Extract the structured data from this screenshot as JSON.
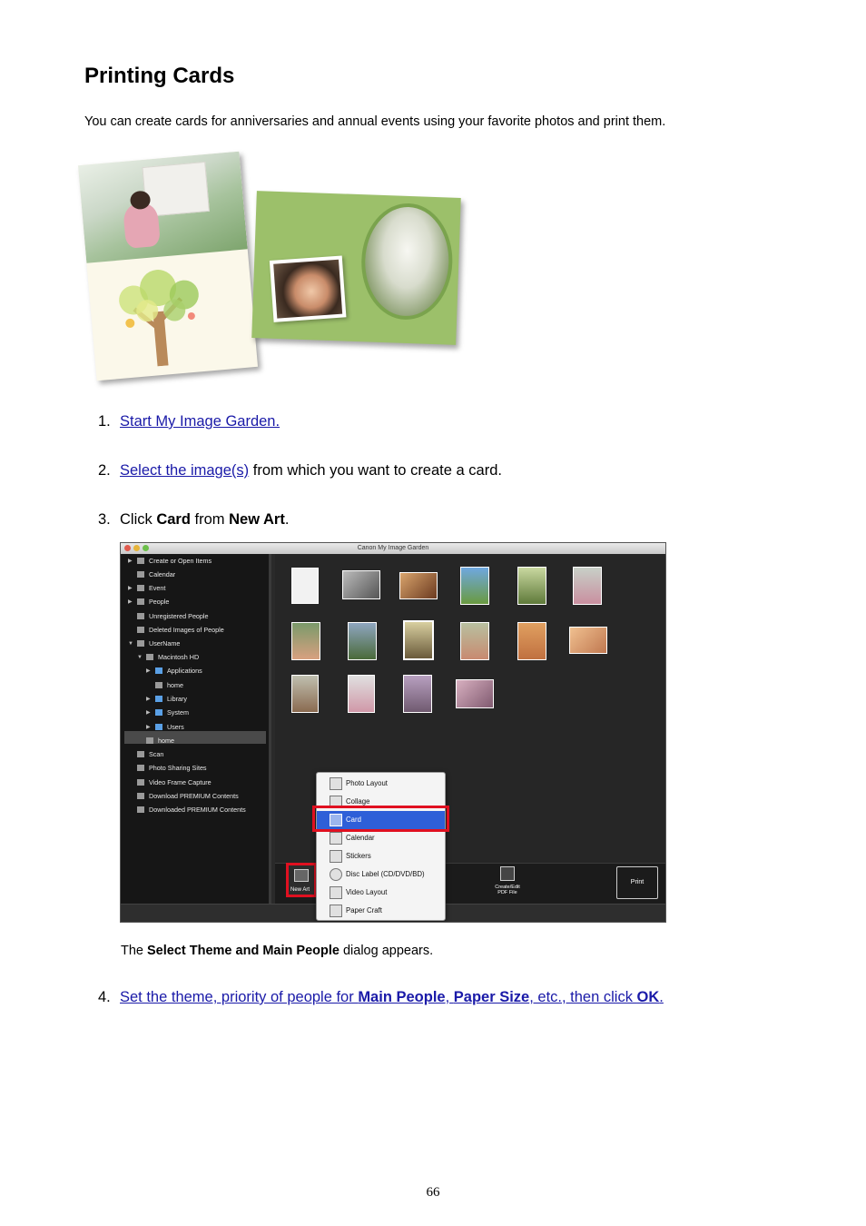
{
  "title": "Printing Cards",
  "intro": "You can create cards for anniversaries and annual events using your favorite photos and print them.",
  "steps": [
    {
      "num": "1.",
      "link": "Start My Image Garden."
    },
    {
      "num": "2.",
      "link": "Select the image(s)",
      "rest": " from which you want to create a card."
    },
    {
      "num": "3.",
      "pre": "Click ",
      "bold1": "Card",
      "mid": " from ",
      "bold2": "New Art",
      "post": "."
    },
    {
      "num": "4.",
      "link_pre": "Set the theme, priority of people for ",
      "b1": "Main People",
      "s1": ", ",
      "b2": "Paper Size",
      "s2": ", etc., then click ",
      "b3": "OK",
      "s3": "."
    }
  ],
  "note": {
    "pre": "The ",
    "bold": "Select Theme and Main People",
    "post": " dialog appears."
  },
  "app": {
    "window_title": "Canon My Image Garden",
    "sidebar": [
      "Create or Open Items",
      "Calendar",
      "Event",
      "People",
      "Unregistered People",
      "Deleted Images of People",
      "UserName",
      "Macintosh HD",
      "Applications",
      "home",
      "Library",
      "System",
      "Users",
      "home",
      "Scan",
      "Photo Sharing Sites",
      "Video Frame Capture",
      "Download PREMIUM Contents",
      "Downloaded PREMIUM Contents"
    ],
    "menu": [
      "Photo Layout",
      "Collage",
      "Card",
      "Calendar",
      "Stickers",
      "Disc Label (CD/DVD/BD)",
      "Video Layout",
      "Paper Craft"
    ],
    "new_art_label": "New Art",
    "pdf_label_1": "Create/Edit",
    "pdf_label_2": "PDF File",
    "print_label": "Print"
  },
  "page_number": "66"
}
